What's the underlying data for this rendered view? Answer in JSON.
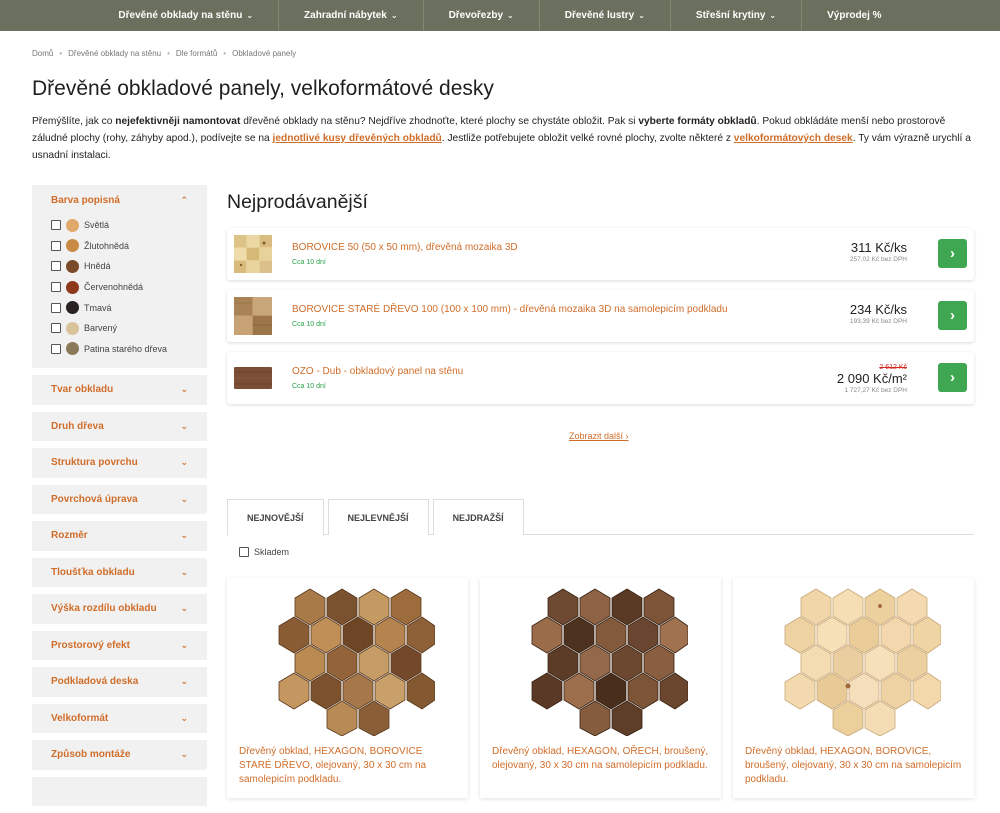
{
  "nav": [
    {
      "label": "Dřevěné obklady na stěnu",
      "chevron": true
    },
    {
      "label": "Zahradní nábytek",
      "chevron": true
    },
    {
      "label": "Dřevořezby",
      "chevron": true
    },
    {
      "label": "Dřevěné lustry",
      "chevron": true
    },
    {
      "label": "Střešní krytiny",
      "chevron": true
    },
    {
      "label": "Výprodej %",
      "chevron": false
    }
  ],
  "breadcrumb": [
    "Domů",
    "Dřevěné obklady na stěnu",
    "Dle formátů",
    "Obkladové panely"
  ],
  "page_title": "Dřevěné obkladové panely, velkoformátové desky",
  "intro": {
    "t1": "Přemýšlíte, jak co ",
    "b1": "nejefektivněji namontovat",
    "t2": " dřevěné obklady na stěnu? Nejdříve zhodnoťte, které plochy se chystáte obložit. Pak si ",
    "b2": "vyberte formáty obkladů",
    "t3": ". Pokud obkládáte menší nebo prostorově záludné plochy (rohy, záhyby apod.), podívejte se na ",
    "link1": "jednotlivé kusy dřevěných obkladů",
    "t4": ". Jestliže potřebujete obložit velké rovné plochy, zvolte některé z ",
    "link2": "velkoformátových desek",
    "t5": ". Ty vám výrazně urychlí a usnadní instalaci."
  },
  "sidebar": {
    "open_filter": {
      "title": "Barva popisná",
      "items": [
        {
          "label": "Světlá",
          "color": "#e0a86a"
        },
        {
          "label": "Žlutohnědá",
          "color": "#c98a44"
        },
        {
          "label": "Hnědá",
          "color": "#7a4a2a"
        },
        {
          "label": "Červenohnědá",
          "color": "#8e3a1a"
        },
        {
          "label": "Tmavá",
          "color": "#2a2220"
        },
        {
          "label": "Barvený",
          "color": "#d9c39a"
        },
        {
          "label": "Patina starého dřeva",
          "color": "#8a7a5a"
        }
      ]
    },
    "filters": [
      "Tvar obkladu",
      "Druh dřeva",
      "Struktura povrchu",
      "Povrchová úprava",
      "Rozměr",
      "Tloušťka obkladu",
      "Výška rozdílu obkladu",
      "Prostorový efekt",
      "Podkladová deska",
      "Velkoformát",
      "Způsob montáže"
    ]
  },
  "bestsellers": {
    "title": "Nejprodávanější",
    "items": [
      {
        "name": "BOROVICE 50 (50 x 50 mm), dřevěná mozaika 3D",
        "availability": "Cca 10 dní",
        "old_price": "",
        "price": "311 Kč/ks",
        "price_ex_vat": "257,02 Kč bez DPH"
      },
      {
        "name": "BOROVICE STARÉ DŘEVO 100 (100 x 100 mm) - dřevěná mozaika 3D na samolepicím podkladu",
        "availability": "Cca 10 dní",
        "old_price": "",
        "price": "234 Kč/ks",
        "price_ex_vat": "193,39 Kč bez DPH"
      },
      {
        "name": "OZO - Dub - obkladový panel na stěnu",
        "availability": "Cca 10 dní",
        "old_price": "2 612 Kč",
        "price": "2 090 Kč/m²",
        "price_ex_vat": "1 727,27 Kč bez DPH"
      }
    ],
    "more": "Zobrazit další"
  },
  "tabs": [
    "NEJNOVĚJŠÍ",
    "NEJLEVNĚJŠÍ",
    "NEJDRAŽŠÍ"
  ],
  "in_stock_label": "Skladem",
  "products": [
    {
      "name": "Dřevěný obklad, HEXAGON, BOROVICE STARÉ DŘEVO, olejovaný, 30 x 30 cm na samolepicím podkladu."
    },
    {
      "name": "Dřevěný obklad, HEXAGON, OŘECH, broušený, olejovaný, 30 x 30 cm na samolepicím podkladu."
    },
    {
      "name": "Dřevěný obklad, HEXAGON, BOROVICE, broušený, olejovaný, 30 x 30 cm na samolepicím podkladu."
    }
  ],
  "colors": {
    "accent": "#d06d2a",
    "nav_bg": "#6b6f5d",
    "green": "#3fa652",
    "sale_red": "#d7261e"
  }
}
